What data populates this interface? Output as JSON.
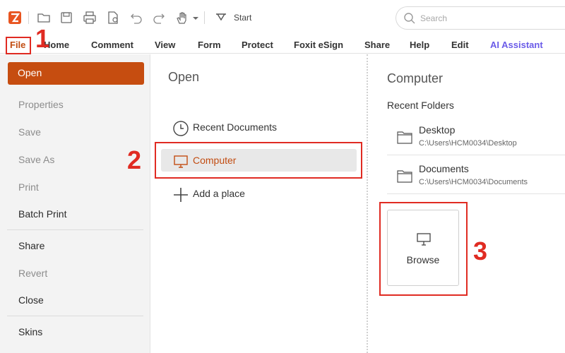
{
  "toolbar": {
    "start_label": "Start",
    "search_placeholder": "Search",
    "icons": [
      "foxit-logo-icon",
      "folder-open-icon",
      "save-icon",
      "print-icon",
      "pdf-icon",
      "undo-icon",
      "redo-icon",
      "hand-tool-icon",
      "dropdown-icon",
      "start-icon",
      "search-icon"
    ]
  },
  "menu": {
    "items": [
      "File",
      "Home",
      "Comment",
      "View",
      "Form",
      "Protect",
      "Foxit eSign",
      "Share",
      "Help",
      "Edit",
      "AI Assistant"
    ]
  },
  "left_panel": {
    "open": "Open",
    "properties": "Properties",
    "save": "Save",
    "save_as": "Save As",
    "print": "Print",
    "batch_print": "Batch Print",
    "share": "Share",
    "revert": "Revert",
    "close": "Close",
    "skins": "Skins"
  },
  "middle_panel": {
    "title": "Open",
    "items": [
      {
        "label": "Recent Documents",
        "icon": "clock-icon"
      },
      {
        "label": "Computer",
        "icon": "computer-icon",
        "selected": true
      },
      {
        "label": "Add a place",
        "icon": "plus-icon"
      }
    ]
  },
  "right_panel": {
    "title": "Computer",
    "subtitle": "Recent Folders",
    "folders": [
      {
        "name": "Desktop",
        "path": "C:\\Users\\HCM0034\\Desktop"
      },
      {
        "name": "Documents",
        "path": "C:\\Users\\HCM0034\\Documents"
      }
    ],
    "browse_label": "Browse"
  },
  "annotations": {
    "step1": "1",
    "step2": "2",
    "step3": "3",
    "color": "#e02b22"
  },
  "colors": {
    "accent": "#c64d10",
    "ai_assistant": "#6a5be8"
  }
}
